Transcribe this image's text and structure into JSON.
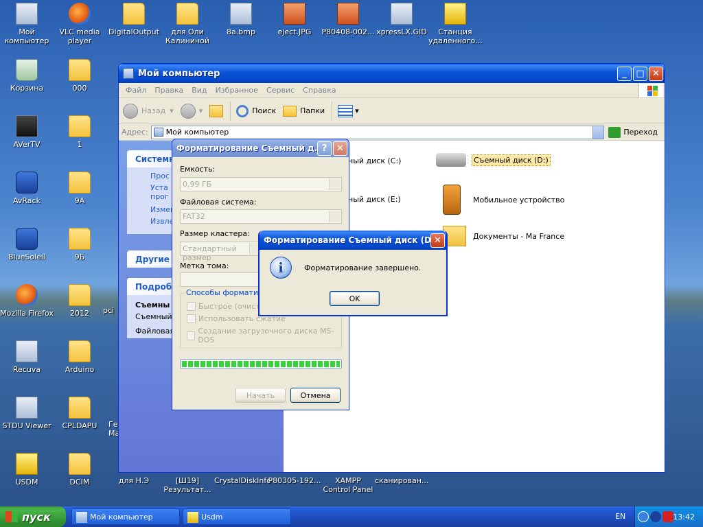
{
  "desktop": {
    "icons": [
      {
        "label": "Мой компьютер"
      },
      {
        "label": "VLC media player"
      },
      {
        "label": "DigitalOutput"
      },
      {
        "label": "для Оли Калининой"
      },
      {
        "label": "8a.bmp"
      },
      {
        "label": "eject.JPG"
      },
      {
        "label": "P80408-002..."
      },
      {
        "label": "xpressLX.GID"
      },
      {
        "label": "Станция удаленного..."
      },
      {
        "label": "Корзина"
      },
      {
        "label": "000"
      },
      {
        "label": "AVerTV"
      },
      {
        "label": "1"
      },
      {
        "label": "AvRack"
      },
      {
        "label": "9А"
      },
      {
        "label": "BlueSoleil"
      },
      {
        "label": "9Б"
      },
      {
        "label": "Mozilla Firefox"
      },
      {
        "label": "2012"
      },
      {
        "label": "Recuva"
      },
      {
        "label": "Arduino"
      },
      {
        "label": "STDU Viewer"
      },
      {
        "label": "CPLDAPU"
      },
      {
        "label": "USDM"
      },
      {
        "label": "DCIM"
      },
      {
        "label": "для Н.Э"
      },
      {
        "label": "[Ш19] Результат..."
      },
      {
        "label": "CrystalDiskInfo"
      },
      {
        "label": "P80305-192..."
      },
      {
        "label": "XAMPP Control Panel"
      },
      {
        "label": "сканирован..."
      }
    ],
    "partial_labels": [
      "pci",
      "Ге Ma"
    ]
  },
  "explorer": {
    "title": "Мой компьютер",
    "menu": [
      "Файл",
      "Правка",
      "Вид",
      "Избранное",
      "Сервис",
      "Справка"
    ],
    "toolbar": {
      "back": "Назад",
      "search": "Поиск",
      "folders": "Папки"
    },
    "address_label": "Адрес:",
    "address_value": "Мой компьютер",
    "go_label": "Переход",
    "left_panels": {
      "system": {
        "title": "Системн",
        "links": [
          "Прос",
          "Устан прогр",
          "Измен",
          "Извле"
        ]
      },
      "other": {
        "title": "Другие м"
      },
      "details": {
        "title": "Подробн",
        "name": "Съемны",
        "type": "Съемный",
        "fs": "Файловая"
      }
    },
    "items": [
      {
        "label": "ный диск (C:)"
      },
      {
        "label": "Съемный диск (D:)"
      },
      {
        "label": "ный диск (E:)"
      },
      {
        "label": "Мобильное устройство"
      },
      {
        "label": "Документы - Ma France"
      }
    ]
  },
  "format_dialog": {
    "title": "Форматирование Съемный д...",
    "capacity_label": "Емкость:",
    "capacity_value": "0,99 ГБ",
    "fs_label": "Файловая система:",
    "fs_value": "FAT32",
    "cluster_label": "Размер кластера:",
    "cluster_value": "Стандартный размер",
    "volume_label": "Метка тома:",
    "volume_value": "",
    "group_title": "Способы форматиров",
    "options": [
      "Быстрое (очистка",
      "Использовать сжатие",
      "Создание загрузочного диска MS-DOS"
    ],
    "progress": 1.0,
    "start_label": "Начать",
    "cancel_label": "Отмена"
  },
  "message_box": {
    "title": "Форматирование Съемный диск (D:)",
    "text": "Форматирование завершено.",
    "ok_label": "OK"
  },
  "taskbar": {
    "start_label": "пуск",
    "tasks": [
      {
        "label": "Мой компьютер"
      },
      {
        "label": "Usdm"
      }
    ],
    "lang": "EN",
    "clock": "13:42"
  },
  "colors": {
    "accent": "#0a53d6",
    "progress": "#36d33a",
    "task_link": "#215dc6"
  }
}
